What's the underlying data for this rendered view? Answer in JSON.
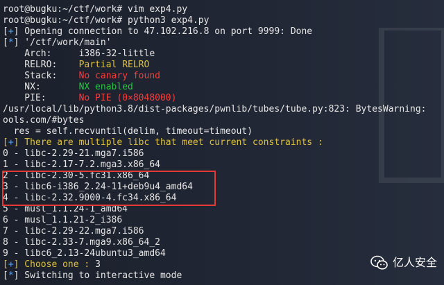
{
  "terminal": {
    "lines": [
      {
        "segments": [
          {
            "text": "root@bugku:~/ctf/work# vim exp4.py",
            "c": "w"
          }
        ]
      },
      {
        "segments": [
          {
            "text": "root@bugku:~/ctf/work# python3 exp4.py",
            "c": "w"
          }
        ]
      },
      {
        "segments": [
          {
            "text": "[",
            "c": "w"
          },
          {
            "text": "+",
            "c": "b"
          },
          {
            "text": "] Opening connection to 47.102.216.8 on port 9999: Done",
            "c": "w"
          }
        ]
      },
      {
        "segments": [
          {
            "text": "[",
            "c": "w"
          },
          {
            "text": "*",
            "c": "b"
          },
          {
            "text": "] '/ctf/work/main'",
            "c": "w"
          }
        ]
      },
      {
        "segments": [
          {
            "text": "    Arch:     i386-32-little",
            "c": "w"
          }
        ]
      },
      {
        "segments": [
          {
            "text": "    RELRO:    ",
            "c": "w"
          },
          {
            "text": "Partial RELRO",
            "c": "y"
          }
        ]
      },
      {
        "segments": [
          {
            "text": "    Stack:    ",
            "c": "w"
          },
          {
            "text": "No canary found",
            "c": "r"
          }
        ]
      },
      {
        "segments": [
          {
            "text": "    NX:       ",
            "c": "w"
          },
          {
            "text": "NX enabled",
            "c": "g"
          }
        ]
      },
      {
        "segments": [
          {
            "text": "    PIE:      ",
            "c": "w"
          },
          {
            "text": "No PIE (0×8048000)",
            "c": "r"
          }
        ]
      },
      {
        "segments": [
          {
            "text": "/usr/local/lib/python3.8/dist-packages/pwnlib/tubes/tube.py:823: BytesWarning:",
            "c": "w"
          }
        ]
      },
      {
        "segments": [
          {
            "text": "ools.com/#bytes",
            "c": "w"
          }
        ]
      },
      {
        "segments": [
          {
            "text": "  res = self.recvuntil(delim, timeout=timeout)",
            "c": "w"
          }
        ]
      },
      {
        "segments": [
          {
            "text": "[",
            "c": "y"
          },
          {
            "text": "+",
            "c": "b"
          },
          {
            "text": "] There are multiple libc that meet current constraints :",
            "c": "y"
          }
        ]
      },
      {
        "segments": [
          {
            "text": "0 - libc-2.29-21.mga7.i586",
            "c": "w"
          }
        ]
      },
      {
        "segments": [
          {
            "text": "1 - libc-2.17-7.2.mga3.x86_64",
            "c": "w"
          }
        ]
      },
      {
        "segments": [
          {
            "text": "2 - libc-2.30-5.fc31.x86_64",
            "c": "w"
          }
        ]
      },
      {
        "segments": [
          {
            "text": "3 - libc6-i386_2.24-11+deb9u4_amd64",
            "c": "w"
          }
        ]
      },
      {
        "segments": [
          {
            "text": "4 - libc-2.32.9000-4.fc34.x86_64",
            "c": "w"
          }
        ]
      },
      {
        "segments": [
          {
            "text": "5 - musl_1.1.24-1_amd64",
            "c": "w"
          }
        ]
      },
      {
        "segments": [
          {
            "text": "6 - musl_1.1.21-2_i386",
            "c": "w"
          }
        ]
      },
      {
        "segments": [
          {
            "text": "7 - libc-2.29-22.mga7.i586",
            "c": "w"
          }
        ]
      },
      {
        "segments": [
          {
            "text": "8 - libc-2.33-7.mga9.x86_64_2",
            "c": "w"
          }
        ]
      },
      {
        "segments": [
          {
            "text": "9 - libc6_2.13-24ubuntu3_amd64",
            "c": "w"
          }
        ]
      },
      {
        "segments": [
          {
            "text": "[",
            "c": "y"
          },
          {
            "text": "+",
            "c": "b"
          },
          {
            "text": "] Choose one : ",
            "c": "y"
          },
          {
            "text": "3",
            "c": "w"
          }
        ]
      },
      {
        "segments": [
          {
            "text": "[",
            "c": "w"
          },
          {
            "text": "*",
            "c": "b"
          },
          {
            "text": "] Switching to interactive mode",
            "c": "w"
          }
        ]
      }
    ]
  },
  "watermark": {
    "text": "亿人安全",
    "icon": "wechat-icon"
  },
  "colors": {
    "background": "#1f2430",
    "highlight": "#e53935",
    "blue": "#4aa3ff",
    "yellow": "#e0c040",
    "red": "#ff3a3a",
    "green": "#27c93f"
  }
}
